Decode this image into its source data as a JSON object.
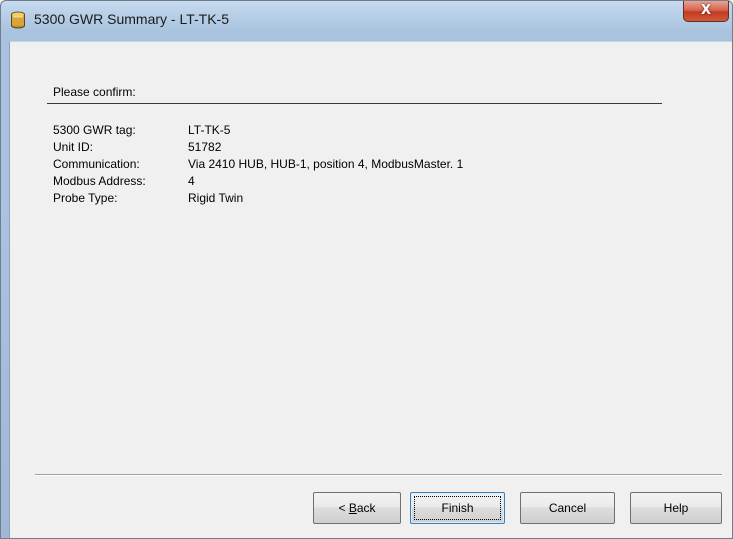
{
  "window": {
    "title": "5300 GWR Summary - LT-TK-5",
    "close_glyph": "X"
  },
  "summary": {
    "heading": "Please confirm:",
    "rows": [
      {
        "label": "5300 GWR tag:",
        "value": "LT-TK-5"
      },
      {
        "label": "Unit ID:",
        "value": "51782"
      },
      {
        "label": "Communication:",
        "value": "Via 2410 HUB,  HUB-1,  position  4, ModbusMaster. 1"
      },
      {
        "label": "Modbus Address:",
        "value": "4"
      },
      {
        "label": "Probe Type:",
        "value": "Rigid Twin"
      }
    ]
  },
  "buttons": {
    "back_prefix": "< ",
    "back_mnemonic": "B",
    "back_rest": "ack",
    "finish": "Finish",
    "cancel": "Cancel",
    "help": "Help"
  },
  "icons": {
    "title_icon": "tank-icon",
    "close": "close-icon"
  },
  "colors": {
    "titlebar": "#b8cfe7",
    "close_button": "#c13a22",
    "client_background": "#f0f0f0",
    "default_button_border": "#3c7fb1"
  }
}
